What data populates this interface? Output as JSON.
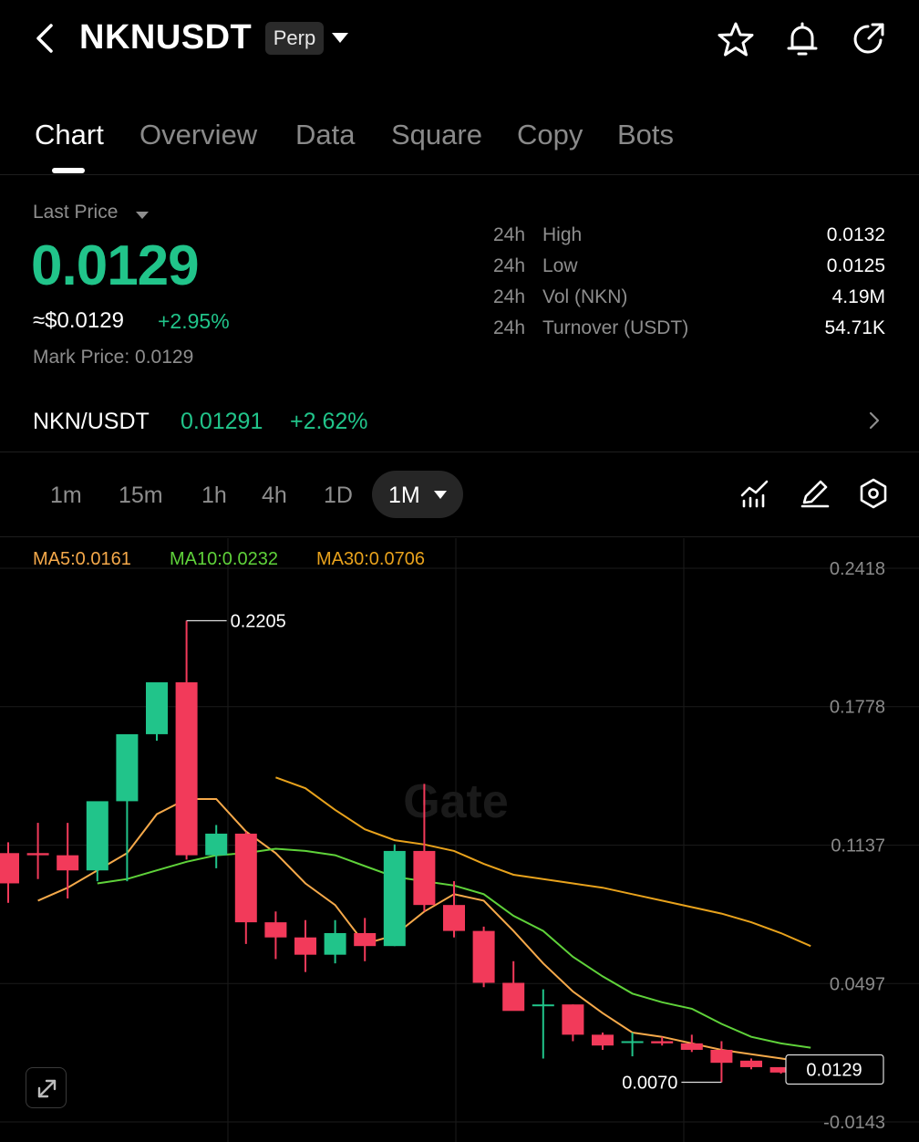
{
  "header": {
    "symbol": "NKNUSDT",
    "contract_type": "Perp",
    "icons": [
      "back-arrow-icon",
      "star-icon",
      "bell-icon",
      "share-icon"
    ]
  },
  "tabs": [
    {
      "label": "Chart",
      "active": true
    },
    {
      "label": "Overview",
      "active": false
    },
    {
      "label": "Data",
      "active": false
    },
    {
      "label": "Square",
      "active": false
    },
    {
      "label": "Copy",
      "active": false
    },
    {
      "label": "Bots",
      "active": false
    }
  ],
  "price_block": {
    "label": "Last Price",
    "last_price": "0.0129",
    "approx_usd": "≈$0.0129",
    "change": "+2.95%",
    "mark_price": "Mark Price: 0.0129"
  },
  "stats": [
    {
      "prefix": "24h",
      "label": "High",
      "value": "0.0132"
    },
    {
      "prefix": "24h",
      "label": "Low",
      "value": "0.0125"
    },
    {
      "prefix": "24h",
      "label": "Vol (NKN)",
      "value": "4.19M"
    },
    {
      "prefix": "24h",
      "label": "Turnover (USDT)",
      "value": "54.71K"
    }
  ],
  "spot": {
    "name": "NKN/USDT",
    "price": "0.01291",
    "change": "+2.62%"
  },
  "intervals": {
    "options": [
      "1m",
      "15m",
      "1h",
      "4h",
      "1D"
    ],
    "selected": "1M"
  },
  "chart_icons": [
    "indicator-icon",
    "draw-icon",
    "settings-icon"
  ],
  "indicators": {
    "ma5": "MA5:0.0161",
    "ma10": "MA10:0.0232",
    "ma30": "MA30:0.0706"
  },
  "colors": {
    "up": "#21c48a",
    "down": "#f23a5a",
    "ma5": "#f5a94a",
    "ma10": "#5fd23a",
    "ma30": "#e8a21c"
  },
  "watermark": "Gate",
  "chart_data": {
    "type": "candlestick",
    "y_axis_ticks": [
      "0.2418",
      "0.1778",
      "0.1137",
      "0.0497",
      "-0.0143"
    ],
    "y_range": [
      -0.0143,
      0.2418
    ],
    "annotations": {
      "max_label": "0.2205",
      "min_label": "0.0070",
      "current_price_label": "0.0129"
    },
    "candles": [
      {
        "o": 0.113,
        "h": 0.118,
        "l": 0.09,
        "c": 0.099
      },
      {
        "o": 0.113,
        "h": 0.127,
        "l": 0.101,
        "c": 0.112
      },
      {
        "o": 0.112,
        "h": 0.127,
        "l": 0.092,
        "c": 0.105
      },
      {
        "o": 0.105,
        "h": 0.131,
        "l": 0.1,
        "c": 0.137
      },
      {
        "o": 0.137,
        "h": 0.157,
        "l": 0.1,
        "c": 0.168
      },
      {
        "o": 0.168,
        "h": 0.184,
        "l": 0.165,
        "c": 0.192
      },
      {
        "o": 0.192,
        "h": 0.2205,
        "l": 0.11,
        "c": 0.112
      },
      {
        "o": 0.112,
        "h": 0.126,
        "l": 0.106,
        "c": 0.122
      },
      {
        "o": 0.122,
        "h": 0.123,
        "l": 0.071,
        "c": 0.081
      },
      {
        "o": 0.081,
        "h": 0.086,
        "l": 0.064,
        "c": 0.074
      },
      {
        "o": 0.074,
        "h": 0.082,
        "l": 0.058,
        "c": 0.066
      },
      {
        "o": 0.066,
        "h": 0.082,
        "l": 0.062,
        "c": 0.076
      },
      {
        "o": 0.076,
        "h": 0.083,
        "l": 0.063,
        "c": 0.07
      },
      {
        "o": 0.07,
        "h": 0.117,
        "l": 0.07,
        "c": 0.114
      },
      {
        "o": 0.114,
        "h": 0.145,
        "l": 0.086,
        "c": 0.089
      },
      {
        "o": 0.089,
        "h": 0.1,
        "l": 0.074,
        "c": 0.077
      },
      {
        "o": 0.077,
        "h": 0.079,
        "l": 0.051,
        "c": 0.053
      },
      {
        "o": 0.053,
        "h": 0.063,
        "l": 0.044,
        "c": 0.04
      },
      {
        "o": 0.043,
        "h": 0.05,
        "l": 0.018,
        "c": 0.043
      },
      {
        "o": 0.043,
        "h": 0.043,
        "l": 0.026,
        "c": 0.029
      },
      {
        "o": 0.029,
        "h": 0.03,
        "l": 0.022,
        "c": 0.024
      },
      {
        "o": 0.026,
        "h": 0.03,
        "l": 0.019,
        "c": 0.026
      },
      {
        "o": 0.026,
        "h": 0.028,
        "l": 0.024,
        "c": 0.025
      },
      {
        "o": 0.025,
        "h": 0.029,
        "l": 0.021,
        "c": 0.022
      },
      {
        "o": 0.022,
        "h": 0.026,
        "l": 0.007,
        "c": 0.016
      },
      {
        "o": 0.017,
        "h": 0.018,
        "l": 0.013,
        "c": 0.014
      },
      {
        "o": 0.014,
        "h": 0.014,
        "l": 0.011,
        "c": 0.0115
      },
      {
        "o": 0.0125,
        "h": 0.0135,
        "l": 0.0115,
        "c": 0.0129
      }
    ],
    "ma_series": [
      {
        "name": "MA5",
        "values": [
          0.091,
          0.097,
          0.105,
          0.113,
          0.131,
          0.138,
          0.138,
          0.123,
          0.113,
          0.099,
          0.089,
          0.071,
          0.075,
          0.086,
          0.094,
          0.091,
          0.077,
          0.062,
          0.049,
          0.039,
          0.03,
          0.028,
          0.025,
          0.022,
          0.02,
          0.018,
          0.016
        ]
      },
      {
        "name": "MA10",
        "values": [
          0.099,
          0.101,
          0.105,
          0.109,
          0.112,
          0.113,
          0.115,
          0.114,
          0.112,
          0.107,
          0.102,
          0.1,
          0.098,
          0.094,
          0.084,
          0.077,
          0.065,
          0.056,
          0.048,
          0.044,
          0.041,
          0.034,
          0.028,
          0.025,
          0.023
        ]
      },
      {
        "name": "MA30",
        "values": [
          0.148,
          0.143,
          0.133,
          0.124,
          0.119,
          0.117,
          0.114,
          0.108,
          0.103,
          0.101,
          0.099,
          0.097,
          0.094,
          0.091,
          0.088,
          0.085,
          0.081,
          0.076,
          0.07
        ]
      }
    ]
  }
}
